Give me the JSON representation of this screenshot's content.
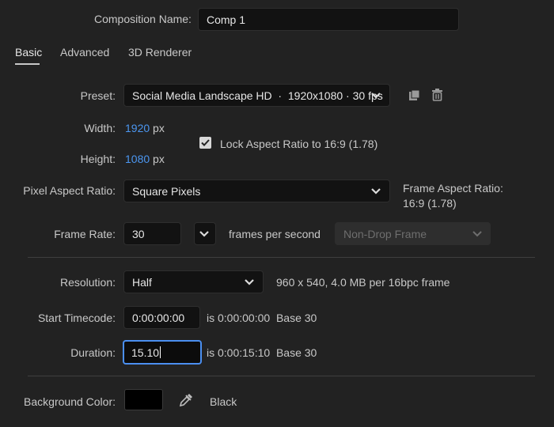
{
  "composition": {
    "name_label": "Composition Name:",
    "name_value": "Comp 1"
  },
  "tabs": [
    {
      "label": "Basic",
      "active": true
    },
    {
      "label": "Advanced",
      "active": false
    },
    {
      "label": "3D Renderer",
      "active": false
    }
  ],
  "preset": {
    "label": "Preset:",
    "value": "Social Media Landscape HD  ·  1920x1080 · 30 fps",
    "save_icon": "save-preset-icon",
    "delete_icon": "trash-icon"
  },
  "width": {
    "label": "Width:",
    "value": "1920",
    "unit": "px"
  },
  "height": {
    "label": "Height:",
    "value": "1080",
    "unit": "px"
  },
  "lock_aspect": {
    "label": "Lock Aspect Ratio to 16:9 (1.78)",
    "checked": true
  },
  "pixel_aspect": {
    "label": "Pixel Aspect Ratio:",
    "value": "Square Pixels",
    "frame_aspect_label": "Frame Aspect Ratio:",
    "frame_aspect_value": "16:9 (1.78)"
  },
  "frame_rate": {
    "label": "Frame Rate:",
    "value": "30",
    "unit": "frames per second",
    "drop_frame": "Non-Drop Frame"
  },
  "resolution": {
    "label": "Resolution:",
    "value": "Half",
    "info": "960 x 540, 4.0 MB per 16bpc frame"
  },
  "start_timecode": {
    "label": "Start Timecode:",
    "value": "0:00:00:00",
    "info": "is 0:00:00:00  Base 30"
  },
  "duration": {
    "label": "Duration:",
    "value": "15.10",
    "info": "is 0:00:15:10  Base 30"
  },
  "background": {
    "label": "Background Color:",
    "color": "#000000",
    "name": "Black",
    "eyedropper_icon": "eyedropper-icon"
  },
  "colors": {
    "accent": "#4b96f0",
    "background": "#222222",
    "field": "#121212"
  }
}
